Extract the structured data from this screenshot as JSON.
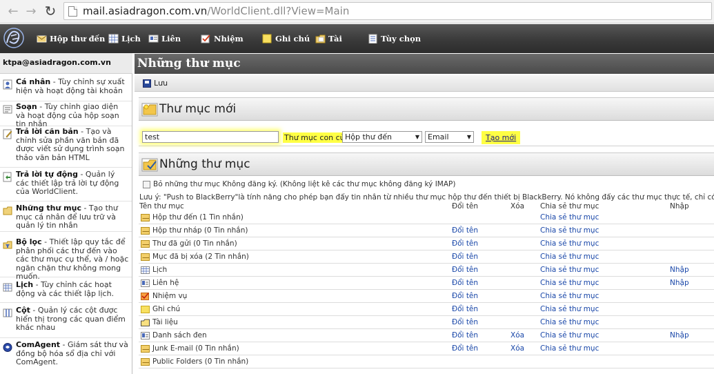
{
  "browser": {
    "url_host": "mail.asiadragon.com.vn",
    "url_path": "/WorldClient.dll?View=Main",
    "back_glyph": "←",
    "forward_glyph": "→",
    "reload_glyph": "↻"
  },
  "nav": {
    "items": [
      {
        "label": "Hộp thư đến",
        "icon": "inbox-icon"
      },
      {
        "label": "Lịch",
        "icon": "calendar-icon"
      },
      {
        "label": "Liên",
        "icon": "contacts-icon"
      },
      {
        "label": "Nhiệm",
        "icon": "tasks-icon"
      },
      {
        "label": "Ghi chú",
        "icon": "notes-icon"
      },
      {
        "label": "Tài",
        "icon": "documents-icon"
      },
      {
        "label": "Tùy chọn",
        "icon": "options-icon"
      }
    ]
  },
  "sidebar": {
    "account": "ktpa@asiadragon.com.vn",
    "items": [
      {
        "title": "Cá nhân",
        "desc": " - Tùy chỉnh sự xuất hiện và hoạt động tài khoản"
      },
      {
        "title": "Soạn",
        "desc": " - Tùy chỉnh giao diện và hoạt động của hộp soạn tin nhắn"
      },
      {
        "title": "Trả lời căn bản",
        "desc": " - Tạo và chỉnh sửa phần văn bản đã được viết sử dụng trình soạn thảo văn bản HTML"
      },
      {
        "title": "Trả lời tự động",
        "desc": " - Quản lý các thiết lập trả lời tự động của WorldClient."
      },
      {
        "title": "Những thư mục",
        "desc": " - Tạo thư mục cá nhân để lưu trữ và quản lý tin nhắn"
      },
      {
        "title": "Bộ lọc",
        "desc": " - Thiết lập quy tắc để phân phối các thư đến vào các thư mục cụ thể, và / hoặc ngăn chặn thư không mong muốn."
      },
      {
        "title": "Lịch",
        "desc": " - Tùy chỉnh các hoạt động và các thiết lập lịch."
      },
      {
        "title": "Cột",
        "desc": " - Quản lý các cột được hiển thị trong các quan điểm khác nhau"
      },
      {
        "title": "ComAgent",
        "desc": " - Giám sát thư và đồng bộ hóa sổ địa chỉ với ComAgent."
      }
    ]
  },
  "main": {
    "title": "Những thư mục",
    "save_label": "Lưu",
    "new_folder_heading": "Thư mục mới",
    "new_folder": {
      "name_value": "test",
      "parent_label": "Thư mục con của",
      "parent_value": "Hộp thư đến",
      "type_value": "Email",
      "create_label": "Tạo mới"
    },
    "folders_heading": "Những thư mục",
    "unsubscribe_label": "Bỏ những thư mục Không đăng ký. (Không liệt kê các thư mục không đăng ký IMAP)",
    "note": "Lưu ý: \"Push to BlackBerry\"là tính năng cho phép bạn đẩy tin nhắn từ nhiều thư mục hộp thư đến thiết bị BlackBerry. Nó không đẩy các thư mục thực tế, chỉ có tin nhắn",
    "columns": {
      "name": "Tên thư mục",
      "rename": "Đổi tên",
      "delete": "Xóa",
      "share": "Chia sẻ thư mục",
      "import": "Nhập"
    },
    "folders": [
      {
        "name": "Hộp thư đến (1 Tin nhắn)",
        "icon": "envelope-icon",
        "rename": "",
        "delete": "",
        "share": "Chia sẻ thư mục",
        "import": ""
      },
      {
        "name": "Hộp thư nháp (0 Tin nhắn)",
        "icon": "envelope-icon",
        "rename": "Đổi tên",
        "delete": "",
        "share": "Chia sẻ thư mục",
        "import": ""
      },
      {
        "name": "Thư đã gửi (0 Tin nhắn)",
        "icon": "envelope-icon",
        "rename": "Đổi tên",
        "delete": "",
        "share": "Chia sẻ thư mục",
        "import": ""
      },
      {
        "name": "Mục đã bị xóa (2 Tin nhắn)",
        "icon": "envelope-icon",
        "rename": "Đổi tên",
        "delete": "",
        "share": "Chia sẻ thư mục",
        "import": ""
      },
      {
        "name": "Lịch",
        "icon": "calendar-icon",
        "rename": "Đổi tên",
        "delete": "",
        "share": "Chia sẻ thư mục",
        "import": "Nhập"
      },
      {
        "name": "Liên hệ",
        "icon": "contacts-icon",
        "rename": "Đổi tên",
        "delete": "",
        "share": "Chia sẻ thư mục",
        "import": "Nhập"
      },
      {
        "name": "Nhiệm vụ",
        "icon": "tasks-icon",
        "rename": "Đổi tên",
        "delete": "",
        "share": "Chia sẻ thư mục",
        "import": ""
      },
      {
        "name": "Ghi chú",
        "icon": "notes-icon",
        "rename": "Đổi tên",
        "delete": "",
        "share": "Chia sẻ thư mục",
        "import": ""
      },
      {
        "name": "Tài liệu",
        "icon": "documents-icon",
        "rename": "Đổi tên",
        "delete": "",
        "share": "Chia sẻ thư mục",
        "import": ""
      },
      {
        "name": "Danh sách đen",
        "icon": "contacts-icon",
        "rename": "Đổi tên",
        "delete": "Xóa",
        "share": "Chia sẻ thư mục",
        "import": "Nhập"
      },
      {
        "name": "Junk E-mail (0 Tin nhắn)",
        "icon": "envelope-icon",
        "rename": "Đổi tên",
        "delete": "Xóa",
        "share": "Chia sẻ thư mục",
        "import": ""
      },
      {
        "name": "Public Folders (0 Tin nhắn)",
        "icon": "envelope-icon",
        "rename": "",
        "delete": "",
        "share": "",
        "import": ""
      }
    ]
  },
  "colors": {
    "nav_bg": "#3a3a3a",
    "title_bg": "#555555",
    "link": "#1846a8",
    "highlight": "#ffff44"
  }
}
